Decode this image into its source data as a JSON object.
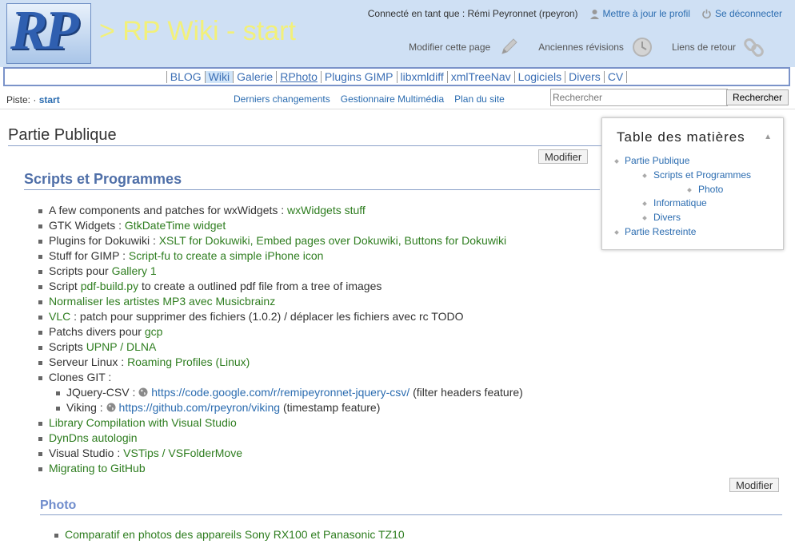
{
  "header": {
    "logo_text": "RP",
    "site_title": "> RP Wiki - start",
    "user_info": "Connecté en tant que : Rémi Peyronnet (rpeyron)",
    "update_profile": "Mettre à jour le profil",
    "logout": "Se déconnecter",
    "page_tools": {
      "edit_page": "Modifier cette page",
      "old_revisions": "Anciennes révisions",
      "backlinks": "Liens de retour"
    }
  },
  "nav": {
    "items": [
      {
        "label": "BLOG"
      },
      {
        "label": "Wiki"
      },
      {
        "label": "Galerie"
      },
      {
        "label": "RPhoto"
      },
      {
        "label": "Plugins GIMP"
      },
      {
        "label": "libxmldiff"
      },
      {
        "label": "xmlTreeNav"
      },
      {
        "label": "Logiciels"
      },
      {
        "label": "Divers"
      },
      {
        "label": "CV"
      }
    ],
    "active": "Wiki"
  },
  "breadcrumb": {
    "label": "Piste:",
    "sep": "·",
    "current": "start"
  },
  "site_tools": {
    "recent_changes": "Derniers changements",
    "media_manager": "Gestionnaire Multimédia",
    "sitemap": "Plan du site"
  },
  "search": {
    "placeholder": "Rechercher",
    "button": "Rechercher"
  },
  "content": {
    "h1": "Partie Publique",
    "edit_label": "Modifier",
    "h2": "Scripts et Programmes",
    "items": {
      "i1_text": "A few components and patches for wxWidgets : ",
      "i1_link": "wxWidgets stuff",
      "i2_text": "GTK Widgets : ",
      "i2_link": "GtkDateTime widget",
      "i3_text": "Plugins for Dokuwiki : ",
      "i3_link": "XSLT for Dokuwiki, Embed pages over Dokuwiki, Buttons for Dokuwiki",
      "i4_text": "Stuff for GIMP : ",
      "i4_link": "Script-fu to create a simple iPhone icon",
      "i5_text": "Scripts pour ",
      "i5_link": "Gallery 1",
      "i6_text_a": "Script ",
      "i6_link": "pdf-build.py",
      "i6_text_b": " to create a outlined pdf file from a tree of images",
      "i7_link": "Normaliser les artistes MP3 avec Musicbrainz",
      "i8_link": "VLC",
      "i8_text": " : patch pour supprimer des fichiers (1.0.2) / déplacer les fichiers avec rc TODO",
      "i9_text": "Patchs divers pour ",
      "i9_link": "gcp",
      "i10_text": "Scripts ",
      "i10_link": "UPNP / DLNA",
      "i11_text": "Serveur Linux : ",
      "i11_link": "Roaming Profiles (Linux)",
      "i12_text": "Clones GIT :",
      "i13_text_a": "JQuery-CSV : ",
      "i13_link": "https://code.google.com/r/remipeyronnet-jquery-csv/",
      "i13_text_b": " (filter headers feature)",
      "i14_text_a": "Viking : ",
      "i14_link": "https://github.com/rpeyron/viking",
      "i14_text_b": " (timestamp feature)",
      "i15_link": "Library Compilation with Visual Studio",
      "i16_link": "DynDns autologin",
      "i17_text": "Visual Studio : ",
      "i17_link": "VSTips / VSFolderMove",
      "i18_link": "Migrating to GitHub"
    },
    "h3": "Photo",
    "photo_item": "Comparatif en photos des appareils Sony RX100 et Panasonic TZ10"
  },
  "toc": {
    "title": "Table des matières",
    "toggle": "▲",
    "entries": [
      {
        "label": "Partie Publique"
      },
      {
        "label": "Scripts et Programmes"
      },
      {
        "label": "Photo"
      },
      {
        "label": "Informatique"
      },
      {
        "label": "Divers"
      },
      {
        "label": "Partie Restreinte"
      }
    ]
  },
  "colors": {
    "header_bg": "#cfe0f4",
    "link": "#2b6cb0",
    "internal_link": "#2e7d1f",
    "heading_blue": "#4f6fa8"
  }
}
